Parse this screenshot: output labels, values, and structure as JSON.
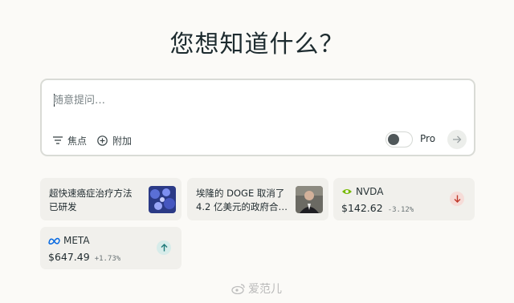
{
  "heading": "您想知道什么？",
  "search": {
    "placeholder": "随意提问…",
    "focus_label": "焦点",
    "attach_label": "附加",
    "pro_label": "Pro"
  },
  "cards": {
    "news": [
      {
        "line1": "超快速癌症治疗方法",
        "line2": "已研发"
      },
      {
        "line1": "埃隆的 DOGE 取消了",
        "line2": "4.2 亿美元的政府合…"
      }
    ],
    "stocks": [
      {
        "name": "NVDA",
        "price": "$142.62",
        "change": "-3.12%",
        "direction": "down",
        "color": "#c0392b"
      },
      {
        "name": "META",
        "price": "$647.49",
        "change": "+1.73%",
        "direction": "up",
        "color": "#1f7a7a"
      }
    ]
  },
  "watermark": "爱范儿",
  "colors": {
    "accent": "#1f7a7a",
    "down": "#c0392b",
    "nvda_green": "#76b900",
    "meta_blue": "#0668e1"
  }
}
